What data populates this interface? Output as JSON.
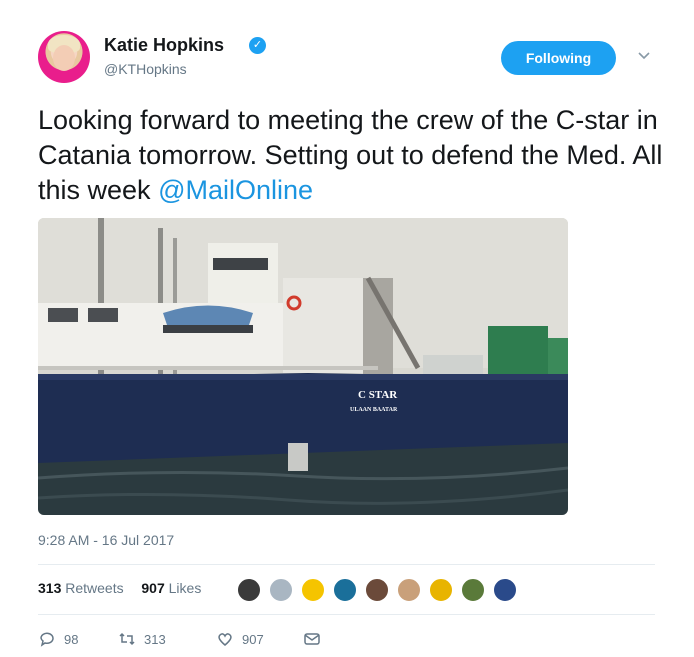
{
  "user": {
    "name": "Katie Hopkins",
    "handle": "@KTHopkins",
    "verified_glyph": "✓"
  },
  "follow_button": {
    "label": "Following"
  },
  "tweet": {
    "text": "Looking forward to meeting the crew of the C-star in Catania tomorrow. Setting out to defend the Med. All this week ",
    "mention": "@MailOnline"
  },
  "photo": {
    "ship_name": "C STAR",
    "ship_port": "ULAAN BAATAR"
  },
  "timestamp": "9:28 AM - 16 Jul 2017",
  "stats": {
    "retweets_count": "313",
    "retweets_label": "Retweets",
    "likes_count": "907",
    "likes_label": "Likes"
  },
  "likers": [
    {
      "color": "#3a3a3a"
    },
    {
      "color": "#a9b6c2"
    },
    {
      "color": "#f5c400"
    },
    {
      "color": "#1a6f9a"
    },
    {
      "color": "#6b4a3a"
    },
    {
      "color": "#c9a07a"
    },
    {
      "color": "#e8b400"
    },
    {
      "color": "#5a7a3a"
    },
    {
      "color": "#2a4a8a"
    }
  ],
  "actions": {
    "replies": "98",
    "retweets": "313",
    "likes": "907"
  },
  "colors": {
    "accent": "#1da1f2",
    "link": "#1b95e0",
    "muted": "#657786"
  }
}
